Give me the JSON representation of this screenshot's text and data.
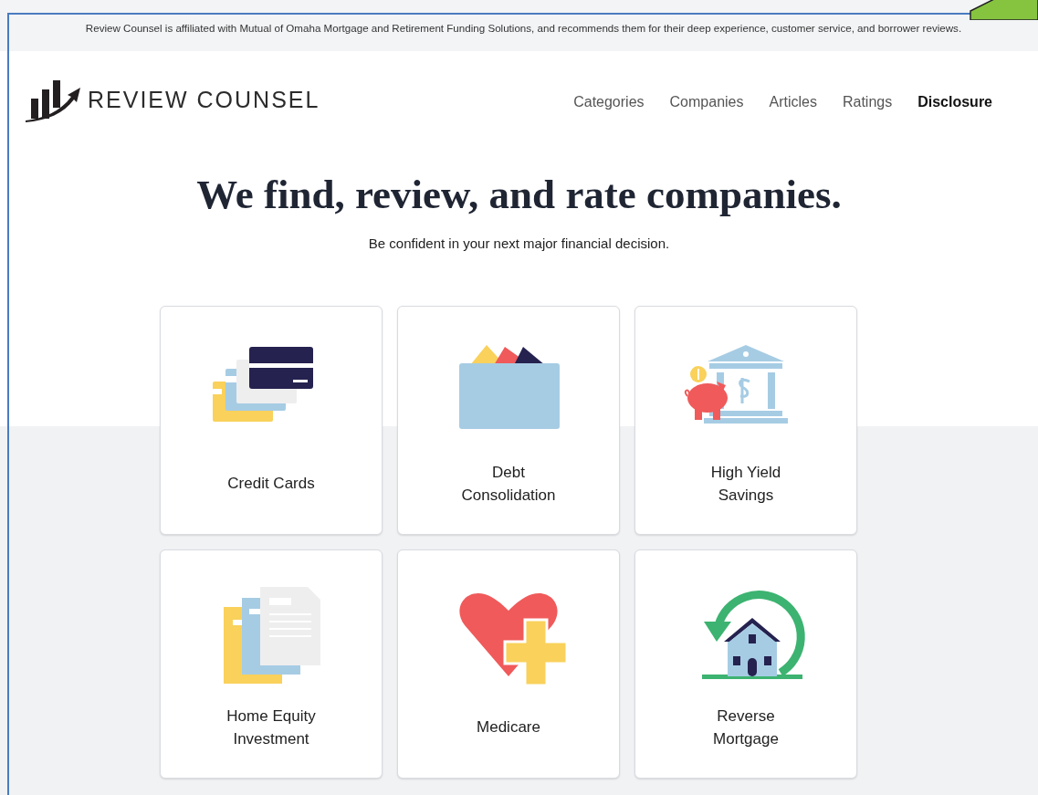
{
  "banner": {
    "text": "Review Counsel is affiliated with Mutual of Omaha Mortgage and Retirement Funding Solutions, and recommends them for their deep experience, customer service, and borrower reviews."
  },
  "header": {
    "logo_text": "REVIEW COUNSEL",
    "nav": [
      {
        "label": "Categories",
        "selected": false
      },
      {
        "label": "Companies",
        "selected": false
      },
      {
        "label": "Articles",
        "selected": false
      },
      {
        "label": "Ratings",
        "selected": false
      },
      {
        "label": "Disclosure",
        "selected": true
      }
    ]
  },
  "hero": {
    "title": "We find, review, and rate companies.",
    "subtitle": "Be confident in your next major financial decision."
  },
  "categories": [
    {
      "label": "Credit Cards",
      "kind": "cards"
    },
    {
      "label": "Debt Consolidation",
      "kind": "wallet"
    },
    {
      "label": "High Yield Savings",
      "kind": "bank"
    },
    {
      "label": "Home Equity Investment",
      "kind": "documents"
    },
    {
      "label": "Medicare",
      "kind": "health"
    },
    {
      "label": "Reverse Mortgage",
      "kind": "house"
    }
  ]
}
